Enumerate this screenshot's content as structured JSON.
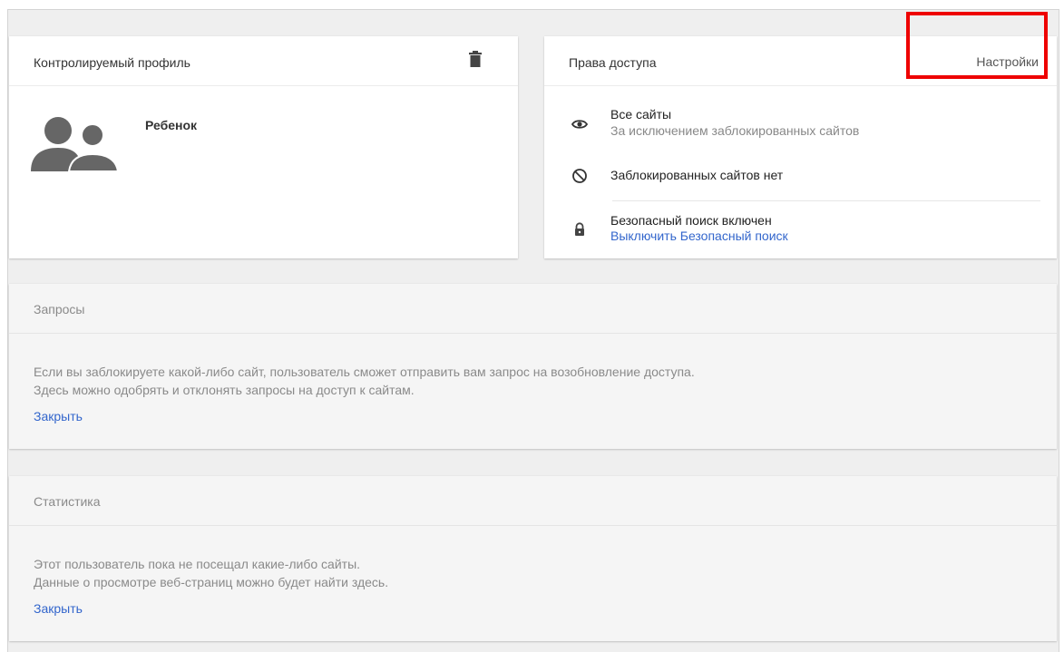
{
  "profile_card": {
    "title": "Контролируемый профиль",
    "delete_icon": "trash-icon",
    "avatar_icon": "supervised-users-icon",
    "child_name": "Ребенок"
  },
  "access_card": {
    "title": "Права доступа",
    "settings_label": "Настройки",
    "all_sites": {
      "icon": "eye-icon",
      "title": "Все сайты",
      "subtitle": "За исключением заблокированных сайтов"
    },
    "blocked_sites": {
      "icon": "block-icon",
      "title": "Заблокированных сайтов нет"
    },
    "safe_search": {
      "icon": "lock-icon",
      "title": "Безопасный поиск включен",
      "link": "Выключить Безопасный поиск"
    }
  },
  "requests_card": {
    "title": "Запросы",
    "line1": "Если вы заблокируете какой-либо сайт, пользователь сможет отправить вам запрос на возобновление доступа.",
    "line2": "Здесь можно одобрять и отклонять запросы на доступ к сайтам.",
    "close_label": "Закрыть"
  },
  "stats_card": {
    "title": "Статистика",
    "line1": "Этот пользователь пока не посещал какие-либо сайты.",
    "line2": "Данные о просмотре веб-страниц можно будет найти здесь.",
    "close_label": "Закрыть"
  },
  "colors": {
    "link": "#3366cc",
    "highlight": "#ee0000",
    "icon": "#555555",
    "background": "#efefef"
  }
}
